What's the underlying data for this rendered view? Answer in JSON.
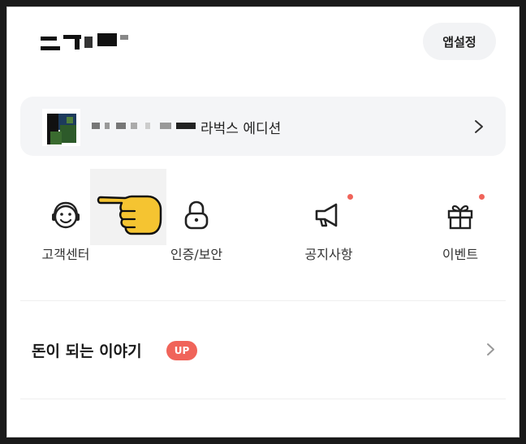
{
  "header": {
    "title_redacted": "(pixelated title)",
    "settings_label": "앱설정"
  },
  "profile": {
    "name_suffix": "라벅스 에디션"
  },
  "menu": [
    {
      "label": "고객센터",
      "icon": "headset-smile-icon",
      "has_dot": false
    },
    {
      "label": "인증/보안",
      "icon": "lock-icon",
      "has_dot": false
    },
    {
      "label": "공지사항",
      "icon": "megaphone-icon",
      "has_dot": true
    },
    {
      "label": "이벤트",
      "icon": "gift-icon",
      "has_dot": true
    }
  ],
  "story": {
    "title": "돈이 되는 이야기",
    "badge": "UP"
  },
  "colors": {
    "accent": "#f0645a",
    "card_bg": "#f4f5f7",
    "pointer_hand": "#f5c431"
  }
}
